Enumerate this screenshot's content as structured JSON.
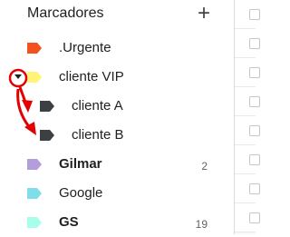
{
  "header": {
    "title": "Marcadores",
    "add_icon": "plus-icon"
  },
  "labels": [
    {
      "name": ".Urgente",
      "color": "#f4511e",
      "bold": false,
      "count": ""
    },
    {
      "name": "cliente VIP",
      "color": "#fff475",
      "bold": false,
      "count": "",
      "expanded": true
    },
    {
      "name": "cliente A",
      "color": "#3c4043",
      "bold": false,
      "count": "",
      "child": true
    },
    {
      "name": "cliente B",
      "color": "#3c4043",
      "bold": false,
      "count": "",
      "child": true
    },
    {
      "name": "Gilmar",
      "color": "#b39ddb",
      "bold": true,
      "count": "2"
    },
    {
      "name": "Google",
      "color": "#80deea",
      "bold": false,
      "count": ""
    },
    {
      "name": "GS",
      "color": "#a7ffeb",
      "bold": true,
      "count": "19"
    }
  ],
  "annotation": {
    "color": "#e30000",
    "target": "expand-collapse toggle of cliente VIP"
  }
}
